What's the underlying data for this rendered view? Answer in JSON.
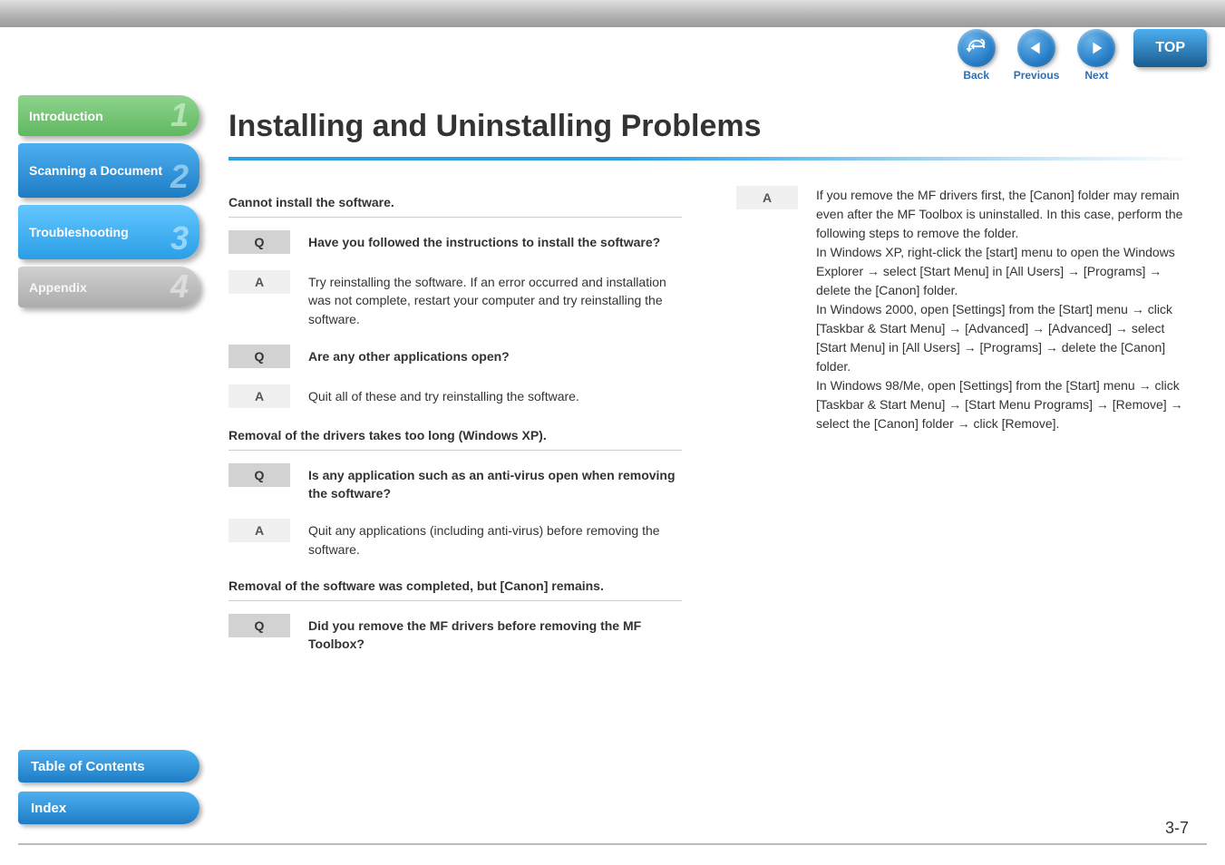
{
  "toolbar": {
    "back_label": "Back",
    "previous_label": "Previous",
    "next_label": "Next",
    "top_label": "TOP"
  },
  "sidebar": {
    "items": [
      {
        "label": "Introduction",
        "num": "1"
      },
      {
        "label": "Scanning a Document",
        "num": "2"
      },
      {
        "label": "Troubleshooting",
        "num": "3"
      },
      {
        "label": "Appendix",
        "num": "4"
      }
    ]
  },
  "bottom": {
    "toc": "Table of Contents",
    "index": "Index"
  },
  "page": {
    "title": "Installing and Uninstalling Problems",
    "number": "3-7"
  },
  "left_column": {
    "sections": [
      {
        "heading": "Cannot install the software.",
        "qa": [
          {
            "type": "Q",
            "text": "Have you followed the instructions to install the software?"
          },
          {
            "type": "A",
            "text": "Try reinstalling the software. If an error occurred and installation was not complete, restart your computer and try reinstalling the software."
          },
          {
            "type": "Q",
            "text": "Are any other applications open?"
          },
          {
            "type": "A",
            "text": "Quit all of these and try reinstalling the software."
          }
        ]
      },
      {
        "heading": "Removal of the drivers takes too long (Windows XP).",
        "qa": [
          {
            "type": "Q",
            "text": "Is any application such as an anti-virus open when removing the software?"
          },
          {
            "type": "A",
            "text": "Quit any applications (including anti-virus) before removing the software."
          }
        ]
      },
      {
        "heading": "Removal of the software was completed, but [Canon] remains.",
        "qa": [
          {
            "type": "Q",
            "text": "Did you remove the MF drivers before removing the MF Toolbox?"
          }
        ]
      }
    ]
  },
  "right_column": {
    "label": "A",
    "text": "If you remove the MF drivers first, the [Canon] folder may remain even after the MF Toolbox is uninstalled. In this case, perform the following steps to remove the folder.\nIn Windows XP, right-click the [start] menu to open the Windows Explorer → select [Start Menu] in [All Users] → [Programs] → delete the [Canon] folder.\nIn Windows 2000, open [Settings] from the [Start] menu → click [Taskbar & Start Menu] → [Advanced] → [Advanced] → select [Start Menu] in [All Users] → [Programs] → delete the [Canon] folder.\nIn Windows 98/Me, open [Settings] from the [Start] menu → click [Taskbar & Start Menu] → [Start Menu Programs] → [Remove] → select the [Canon] folder → click [Remove]."
  }
}
